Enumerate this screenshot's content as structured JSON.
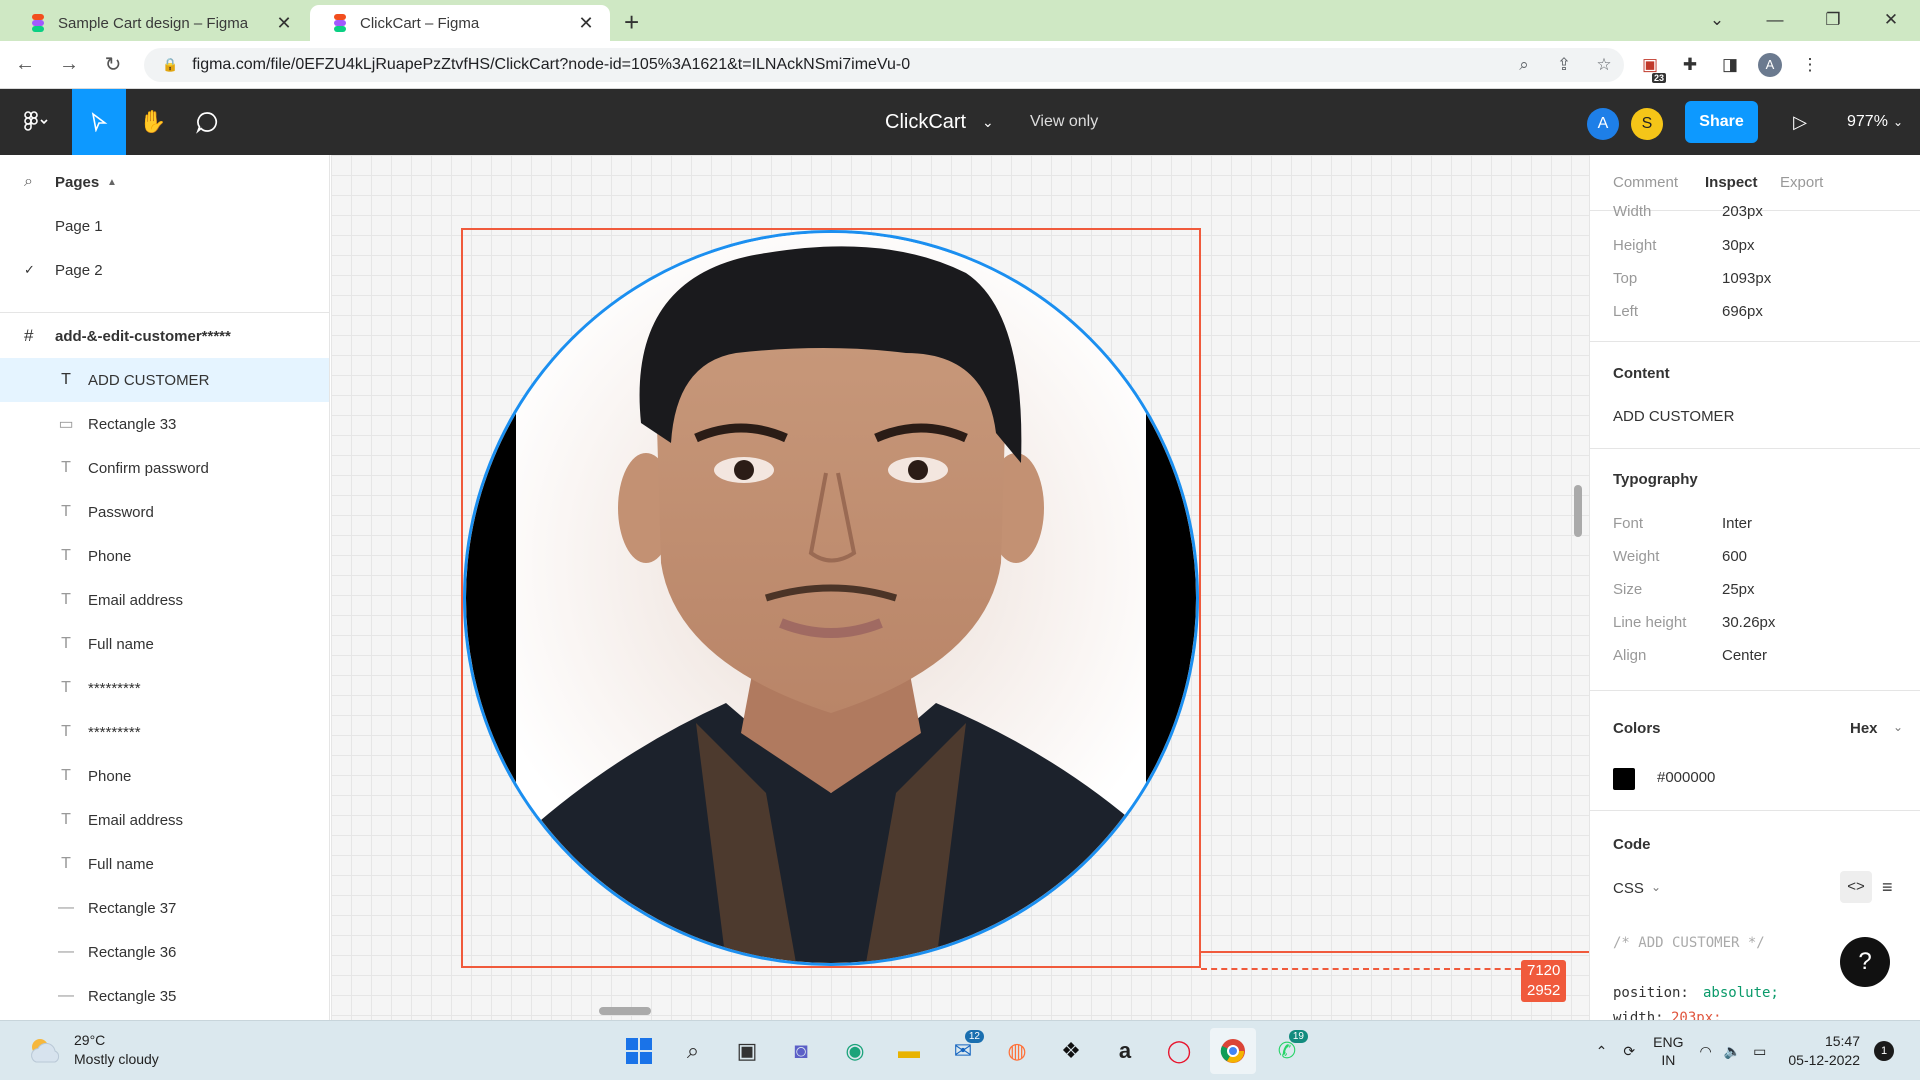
{
  "browser": {
    "tabs": [
      {
        "title": "Sample Cart design – Figma",
        "active": false
      },
      {
        "title": "ClickCart – Figma",
        "active": true
      }
    ],
    "url": "figma.com/file/0EFZU4kLjRuapePzZtvfHS/ClickCart?node-id=105%3A1621&t=ILNAckNSmi7imeVu-0",
    "extension_badge": "23",
    "profile_initial": "A"
  },
  "figma": {
    "file_name": "ClickCart",
    "view_mode": "View only",
    "collaborators": [
      {
        "initial": "A",
        "color": "#1e7fe8"
      },
      {
        "initial": "S",
        "color": "#f5c518"
      }
    ],
    "share_label": "Share",
    "zoom": "977%"
  },
  "layers": {
    "pages_label": "Pages",
    "pages": [
      {
        "name": "Page 1",
        "current": false
      },
      {
        "name": "Page 2",
        "current": true
      }
    ],
    "frame_name": "add-&-edit-customer*****",
    "items": [
      {
        "type": "text",
        "name": "ADD CUSTOMER",
        "selected": true
      },
      {
        "type": "rect",
        "name": "Rectangle 33"
      },
      {
        "type": "text",
        "name": "Confirm password"
      },
      {
        "type": "text",
        "name": "Password"
      },
      {
        "type": "text",
        "name": "Phone"
      },
      {
        "type": "text",
        "name": "Email address"
      },
      {
        "type": "text",
        "name": "Full name"
      },
      {
        "type": "text",
        "name": "*********"
      },
      {
        "type": "text",
        "name": "*********"
      },
      {
        "type": "text",
        "name": "Phone"
      },
      {
        "type": "text",
        "name": "Email address"
      },
      {
        "type": "text",
        "name": "Full name"
      },
      {
        "type": "line",
        "name": "Rectangle 37"
      },
      {
        "type": "line",
        "name": "Rectangle 36"
      },
      {
        "type": "line",
        "name": "Rectangle 35"
      }
    ]
  },
  "canvas": {
    "measure_w": "7120",
    "measure_h": "2952"
  },
  "inspect": {
    "tabs": [
      "Comment",
      "Inspect",
      "Export"
    ],
    "active_tab": "Inspect",
    "props": [
      {
        "k": "Width",
        "v": "203px"
      },
      {
        "k": "Height",
        "v": "30px"
      },
      {
        "k": "Top",
        "v": "1093px"
      },
      {
        "k": "Left",
        "v": "696px"
      }
    ],
    "content_label": "Content",
    "content_value": "ADD CUSTOMER",
    "typography_label": "Typography",
    "typography": [
      {
        "k": "Font",
        "v": "Inter"
      },
      {
        "k": "Weight",
        "v": "600"
      },
      {
        "k": "Size",
        "v": "25px"
      },
      {
        "k": "Line height",
        "v": "30.26px"
      },
      {
        "k": "Align",
        "v": "Center"
      }
    ],
    "colors_label": "Colors",
    "color_format": "Hex",
    "color_value": "#000000",
    "code_label": "Code",
    "code_lang": "CSS",
    "code_comment": "/* ADD CUSTOMER */",
    "code_line1_prop": "position:",
    "code_line1_val": "absolute;",
    "code_line2_prop": "width:",
    "code_line2_val": "203px;"
  },
  "taskbar": {
    "temperature": "29°C",
    "weather": "Mostly cloudy",
    "mail_badge": "12",
    "whatsapp_badge": "19",
    "lang_top": "ENG",
    "lang_bottom": "IN",
    "time": "15:47",
    "date": "05-12-2022",
    "notifications": "1"
  }
}
